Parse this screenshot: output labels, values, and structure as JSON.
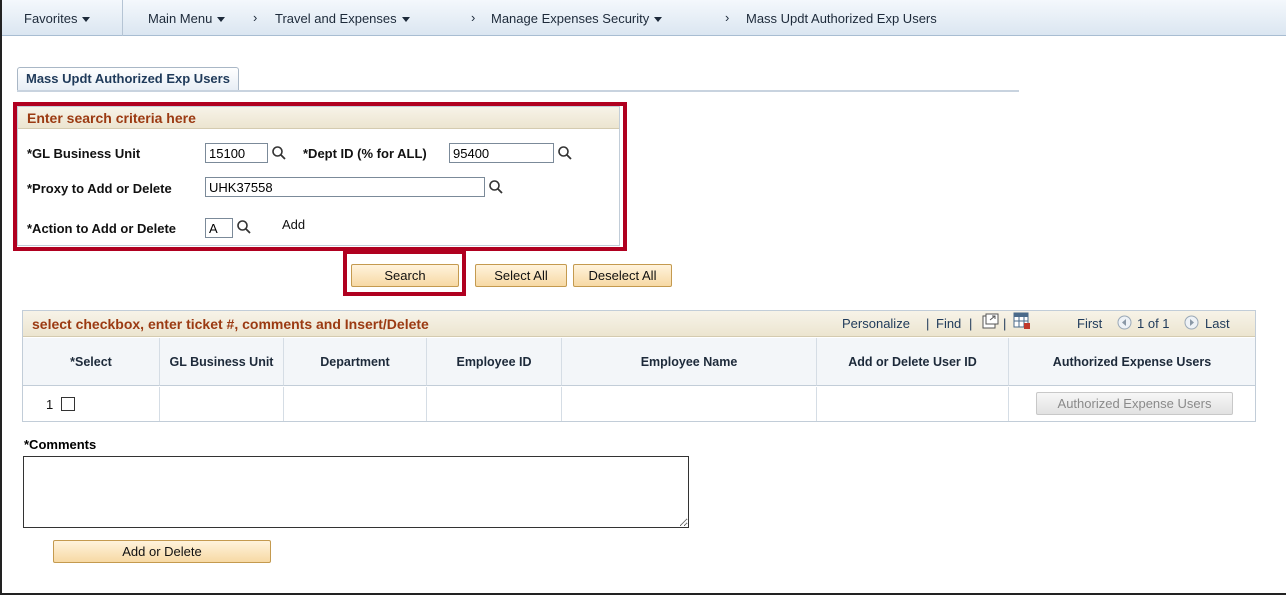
{
  "nav": {
    "favorites": "Favorites",
    "main_menu": "Main Menu",
    "travel": "Travel and Expenses",
    "manage_security": "Manage Expenses Security",
    "current_page": "Mass Updt Authorized Exp Users"
  },
  "tab": {
    "label": "Mass Updt Authorized Exp Users"
  },
  "criteria": {
    "title": "Enter search criteria here",
    "gl_bu_label": "*GL Business Unit",
    "gl_bu_value": "15100",
    "dept_label": "*Dept ID (% for ALL)",
    "dept_value": "95400",
    "proxy_label": "*Proxy to Add or Delete",
    "proxy_value": "UHK37558",
    "action_label": "*Action to Add or Delete",
    "action_value": "A",
    "action_desc": "Add"
  },
  "buttons": {
    "search": "Search",
    "select_all": "Select All",
    "deselect_all": "Deselect All",
    "add_or_delete": "Add or Delete",
    "authorized_users": "Authorized Expense Users"
  },
  "grid": {
    "title": "select checkbox, enter ticket #, comments and Insert/Delete",
    "personalize": "Personalize",
    "find": "Find",
    "first": "First",
    "range": "1 of 1",
    "last": "Last",
    "columns": [
      "*Select",
      "GL Business Unit",
      "Department",
      "Employee ID",
      "Employee Name",
      "Add or Delete User ID",
      "Authorized Expense Users"
    ],
    "row_number": "1"
  },
  "comments": {
    "label": "*Comments",
    "value": ""
  },
  "colors": {
    "highlight": "#b00020",
    "section_title": "#9b3a12",
    "button": "#f7d9a4"
  },
  "icons": [
    "caret-down-icon",
    "chevron-right-icon",
    "lookup-icon",
    "view-all-icon",
    "download-icon",
    "prev-icon",
    "next-icon"
  ]
}
